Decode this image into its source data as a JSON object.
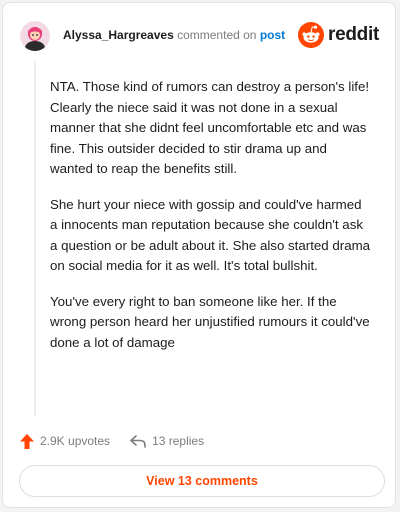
{
  "comment": {
    "username": "Alyssa_Hargreaves",
    "verb": "commented on",
    "target": "post",
    "paragraphs": [
      "NTA. Those kind of rumors can destroy a person's life! Clearly the niece said it was not done in a sexual manner that she didnt feel uncomfortable etc and was fine. This outsider decided to stir drama up and wanted to reap the benefits still.",
      "She hurt your niece with gossip and could've harmed a innocents man reputation because she couldn't ask a question or be adult about it. She also started drama on social media for it as well. It's total bullshit.",
      "You've every right to ban someone like her. If the wrong person heard her unjustified rumours it could've done a lot of damage"
    ]
  },
  "brand": {
    "name": "reddit",
    "icon": "reddit-logo-icon",
    "color": "#ff4500"
  },
  "actions": {
    "upvotes": "2.9K upvotes",
    "replies": "13 replies",
    "upvote_icon": "upvote-arrow-icon",
    "reply_icon": "reply-arrow-icon",
    "upvote_color": "#ff4500"
  },
  "footer": {
    "view_comments": "View 13 comments"
  },
  "colors": {
    "link": "#0079d3",
    "accent": "#ff4500"
  }
}
